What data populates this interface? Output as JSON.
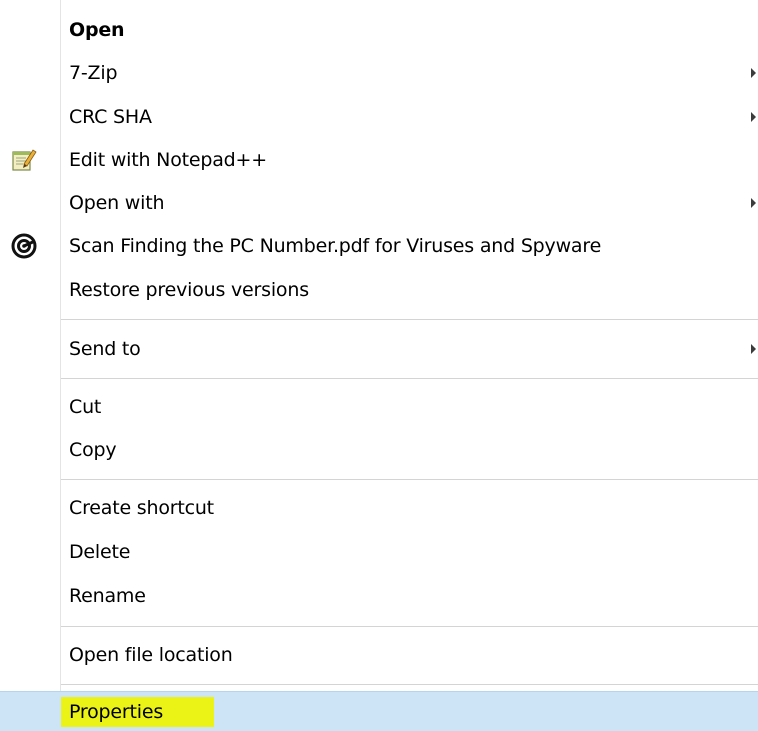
{
  "context_menu": {
    "items": [
      {
        "label": "Open",
        "bold": true
      },
      {
        "label": "7-Zip",
        "submenu": true
      },
      {
        "label": "CRC SHA",
        "submenu": true
      },
      {
        "label": "Edit with Notepad++",
        "icon": "notepad-plus-plus-icon"
      },
      {
        "label": "Open with",
        "submenu": true
      },
      {
        "label": "Scan Finding the PC Number.pdf for Viruses and Spyware",
        "icon": "antivirus-scan-icon"
      },
      {
        "label": "Restore previous versions"
      },
      {
        "label": "Send to",
        "submenu": true
      },
      {
        "label": "Cut"
      },
      {
        "label": "Copy"
      },
      {
        "label": "Create shortcut"
      },
      {
        "label": "Delete"
      },
      {
        "label": "Rename"
      },
      {
        "label": "Open file location"
      },
      {
        "label": "Properties",
        "hovered": true,
        "highlighted_marker": true
      }
    ]
  },
  "colors": {
    "hover_background": "#cde4f7",
    "marker_yellow": "#ecf20a",
    "separator": "#d4d4d4"
  }
}
